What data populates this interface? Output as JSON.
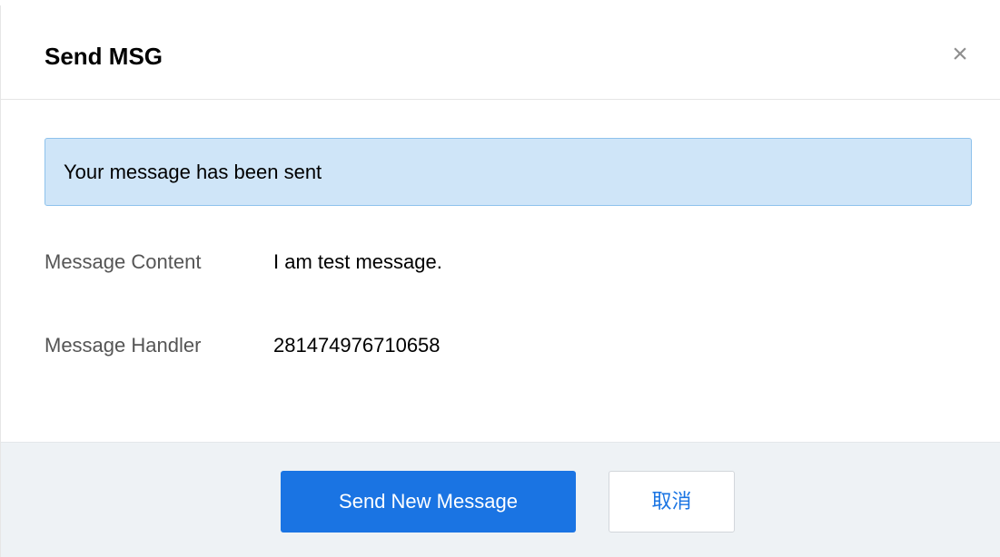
{
  "dialog": {
    "title": "Send MSG",
    "close_glyph": "×"
  },
  "alert": {
    "text": "Your message has been sent",
    "background_color": "#cfe5f8",
    "border_color": "#8ec2ec"
  },
  "fields": [
    {
      "label": "Message Content",
      "value": "I am test message."
    },
    {
      "label": "Message Handler",
      "value": "281474976710658"
    }
  ],
  "footer": {
    "primary_label": "Send New Message",
    "secondary_label": "取消",
    "primary_color": "#1a74e3"
  }
}
